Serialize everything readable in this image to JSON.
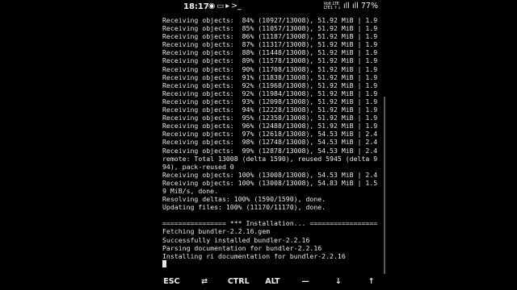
{
  "status_bar": {
    "time": "18:17",
    "left_glyphs": [
      "◉",
      "▭",
      "▸",
      ">_"
    ],
    "network_label_top": "Volt LTE",
    "network_label_bottom": "LTE1 ↑↓",
    "signal": "ıll",
    "battery": "77%"
  },
  "terminal": {
    "lines": [
      "Receiving objects:  84% (10927/13008), 51.92 MiB | 1.9",
      "Receiving objects:  85% (11057/13008), 51.92 MiB | 1.9",
      "Receiving objects:  86% (11187/13008), 51.92 MiB | 1.9",
      "Receiving objects:  87% (11317/13008), 51.92 MiB | 1.9",
      "Receiving objects:  88% (11448/13008), 51.92 MiB | 1.9",
      "Receiving objects:  89% (11578/13008), 51.92 MiB | 1.9",
      "Receiving objects:  90% (11708/13008), 51.92 MiB | 1.9",
      "Receiving objects:  91% (11838/13008), 51.92 MiB | 1.9",
      "Receiving objects:  92% (11968/13008), 51.92 MiB | 1.9",
      "Receiving objects:  92% (11984/13008), 51.92 MiB | 1.9",
      "Receiving objects:  93% (12098/13008), 51.92 MiB | 1.9",
      "Receiving objects:  94% (12228/13008), 51.92 MiB | 1.9",
      "Receiving objects:  95% (12358/13008), 51.92 MiB | 1.9",
      "Receiving objects:  96% (12488/13008), 51.92 MiB | 1.9",
      "Receiving objects:  97% (12618/13008), 54.53 MiB | 2.4",
      "Receiving objects:  98% (12748/13008), 54.53 MiB | 2.4",
      "Receiving objects:  99% (12878/13008), 54.53 MiB | 2.4",
      "remote: Total 13008 (delta 1590), reused 5945 (delta 9",
      "94), pack-reused 0",
      "Receiving objects: 100% (13008/13008), 54.53 MiB | 2.4",
      "Receiving objects: 100% (13008/13008), 54.83 MiB | 1.5",
      "9 MiB/s, done.",
      "Resolving deltas: 100% (1590/1590), done.",
      "Updating files: 100% (11170/11170), done.",
      "",
      "================ *** Installation... =================",
      "Fetching bundler-2.2.16.gem",
      "Successfully installed bundler-2.2.16",
      "Parsing documentation for bundler-2.2.16",
      "Installing ri documentation for bundler-2.2.16"
    ]
  },
  "keys": [
    {
      "label": "ESC",
      "name": "esc-key"
    },
    {
      "label": "⇄",
      "name": "tab-key"
    },
    {
      "label": "CTRL",
      "name": "ctrl-key"
    },
    {
      "label": "ALT",
      "name": "alt-key"
    },
    {
      "label": "—",
      "name": "dash-key"
    },
    {
      "label": "↓",
      "name": "arrow-down-key"
    },
    {
      "label": "↑",
      "name": "arrow-up-key"
    }
  ]
}
